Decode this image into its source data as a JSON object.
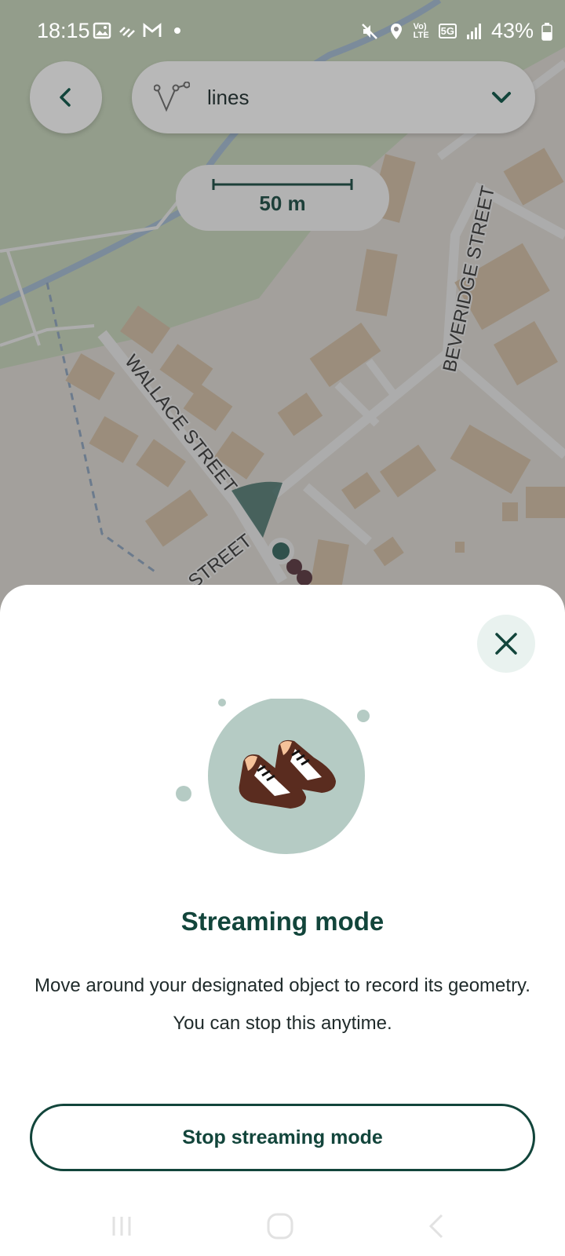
{
  "status_bar": {
    "time": "18:15",
    "battery": "43%",
    "icons_left": [
      "image-icon",
      "signal-stripes-icon",
      "gmail-icon",
      "dot-icon"
    ],
    "icons_right": [
      "mute-icon",
      "location-icon",
      "volte-icon",
      "5g-icon",
      "signal-icon",
      "battery-icon"
    ],
    "volte_label": "Vo) LTE",
    "network_label": "5G"
  },
  "toolbar": {
    "layer_label": "lines"
  },
  "map": {
    "scale_label": "50 m",
    "street_labels": [
      "WALLACE STREET",
      "STREET",
      "BEVERIDGE STREET"
    ]
  },
  "sheet": {
    "title": "Streaming mode",
    "description": "Move around your designated object to record its geometry. You can stop this anytime.",
    "stop_button": "Stop streaming mode"
  },
  "colors": {
    "accent": "#12453b",
    "illustration_circle": "#b5cbc4",
    "close_bg": "#e9f2ef"
  }
}
